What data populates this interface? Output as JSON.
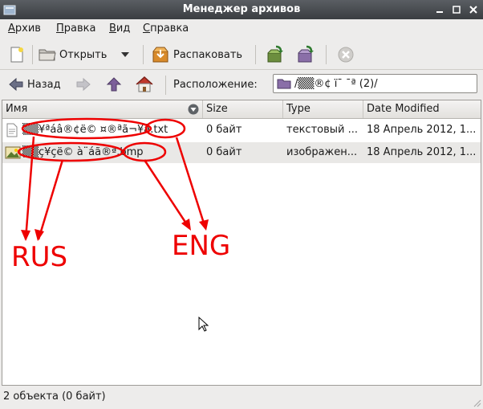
{
  "window": {
    "title": "Менеджер архивов"
  },
  "menu": [
    {
      "label": "Архив"
    },
    {
      "label": "Правка"
    },
    {
      "label": "Вид"
    },
    {
      "label": "Справка"
    }
  ],
  "toolbar": {
    "open_label": "Открыть",
    "extract_label": "Распаковать"
  },
  "nav": {
    "back_label": "Назад",
    "location_label": "Расположение:",
    "location_value": "/▒▒®¢ ï¯ ¯ª (2)/"
  },
  "columns": [
    "Имя",
    "Size",
    "Type",
    "Date Modified"
  ],
  "files": [
    {
      "name": "▒▒¥ªáâ®¢ë© ¤®ªã¬¥­â.txt",
      "size": "0 байт",
      "type": "текстовый ...",
      "date": "18 Апрель 2012, 1..."
    },
    {
      "name": "▒▒ç¥çë© à¨áã­®ª.bmp",
      "size": "0 байт",
      "type": "изображен...",
      "date": "18 Апрель 2012, 1..."
    }
  ],
  "status": "2 объекта (0 байт)",
  "annotations": {
    "rus": "RUS",
    "eng": "ENG"
  },
  "colors": {
    "annotation": "#ee0000",
    "titlebar": "#3a3d41"
  }
}
